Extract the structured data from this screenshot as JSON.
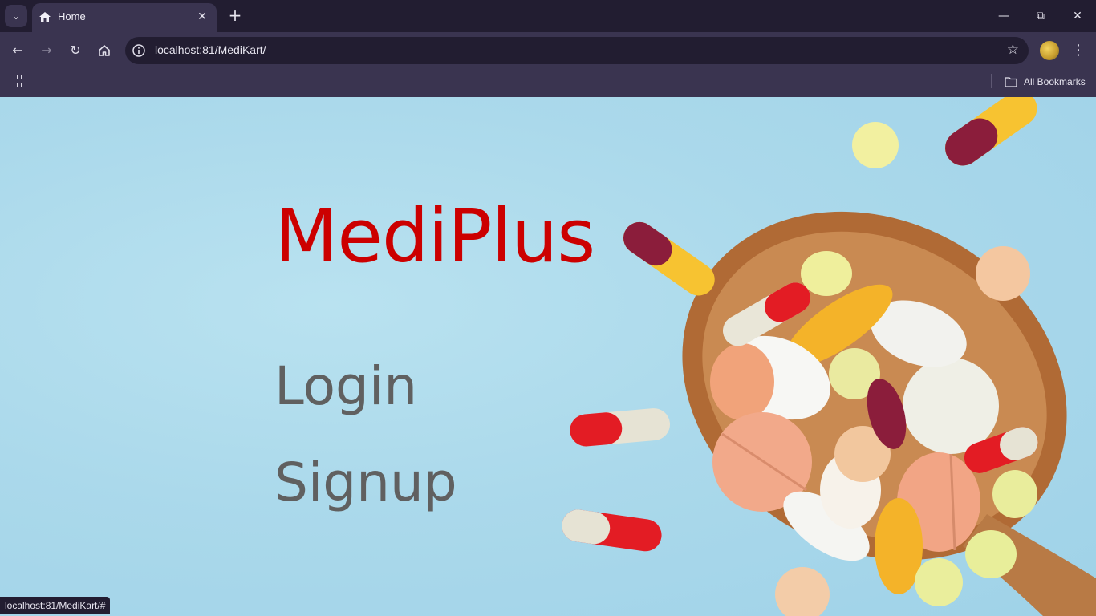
{
  "browser": {
    "tab_title": "Home",
    "address": "localhost:81/MediKart/",
    "bookmarks_label": "All Bookmarks",
    "status_url": "localhost:81/MediKart/#"
  },
  "page": {
    "brand": "MediPlus",
    "nav": {
      "login": "Login",
      "signup": "Signup"
    }
  },
  "colors": {
    "brand": "#cc0000",
    "link": "#606060",
    "background": "#abd9eb"
  },
  "icons": [
    "home-icon",
    "close-icon",
    "plus-icon",
    "back-icon",
    "forward-icon",
    "reload-icon",
    "info-icon",
    "star-icon",
    "apps-icon",
    "folder-icon"
  ]
}
